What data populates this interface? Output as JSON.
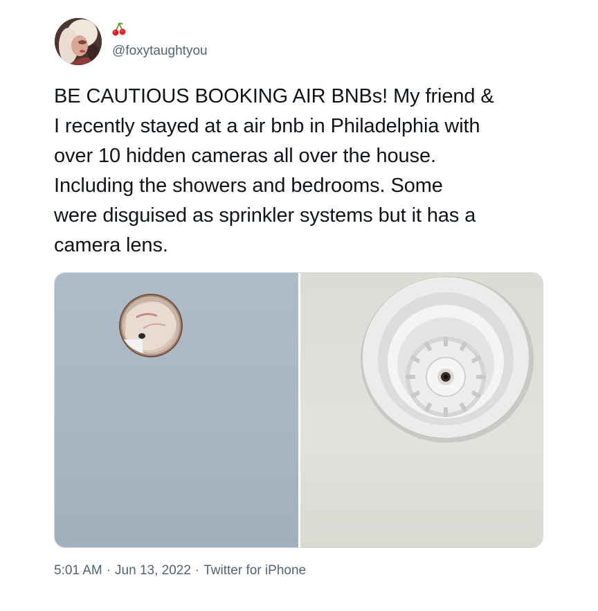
{
  "author": {
    "emoji_icon": "cherry-icon",
    "handle": "@foxytaughtyou"
  },
  "tweet": {
    "text": "BE CAUTIOUS BOOKING AIR BNBs! My friend &\nI recently stayed at a air bnb in Philadelphia with\nover 10 hidden cameras all over the house.\nIncluding the showers and bedrooms. Some\nwere disguised as sprinkler systems but it has a\ncamera lens."
  },
  "meta": {
    "time": "5:01 AM",
    "separator": "·",
    "date": "Jun 13, 2022",
    "source": "Twitter for iPhone"
  },
  "colors": {
    "text": "#0f1419",
    "secondary": "#536471",
    "border": "#cfd9de"
  }
}
